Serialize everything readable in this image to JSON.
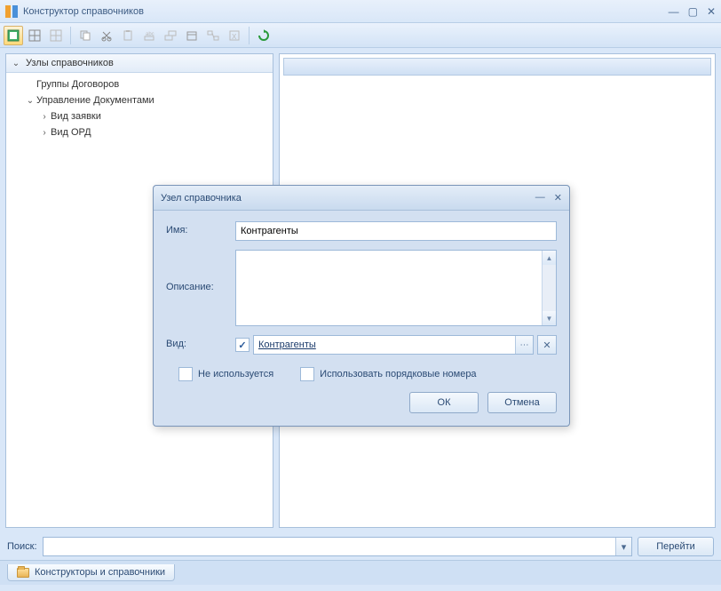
{
  "window": {
    "title": "Конструктор справочников"
  },
  "toolbar": {
    "icons": [
      "new-node-icon",
      "grid-icon",
      "grid-disabled-icon",
      "copy-icon",
      "cut-icon",
      "paste-icon",
      "edit-text-icon",
      "batch-text-icon",
      "calendar-icon",
      "relations-icon",
      "excel-icon",
      "refresh-icon"
    ]
  },
  "tree": {
    "root": {
      "label": "Узлы справочников"
    },
    "items": [
      {
        "label": "Группы Договоров"
      },
      {
        "label": "Управление Документами"
      },
      {
        "label": "Вид заявки"
      },
      {
        "label": "Вид ОРД"
      }
    ]
  },
  "search": {
    "label": "Поиск:",
    "value": "",
    "go": "Перейти"
  },
  "tab": {
    "label": "Конструкторы и справочники"
  },
  "dialog": {
    "title": "Узел справочника",
    "name_label": "Имя:",
    "name_value": "Контрагенты",
    "desc_label": "Описание:",
    "desc_value": "",
    "kind_label": "Вид:",
    "kind_value": "Контрагенты",
    "not_used": "Не используется",
    "use_ordinal": "Использовать порядковые номера",
    "ok": "ОК",
    "cancel": "Отмена"
  }
}
